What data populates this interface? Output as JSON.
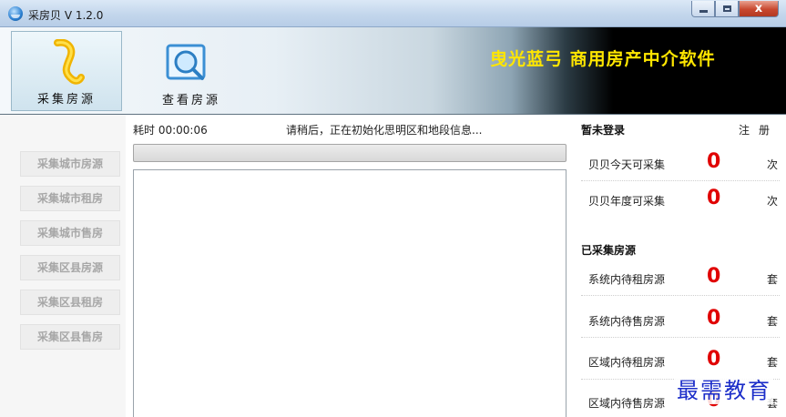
{
  "window": {
    "title": "采房贝 V 1.2.0",
    "buttons": {
      "minimize_icon": "minimize-icon",
      "maximize_icon": "maximize-icon",
      "close_label": "x"
    }
  },
  "toolbar": {
    "collect_label": "采集房源",
    "view_label": "查看房源",
    "brand": "曳光蓝弓 商用房产中介软件",
    "colors": {
      "brand": "#ffe600",
      "banner_dark": "#000000"
    }
  },
  "sidebar": {
    "items": [
      {
        "label": "采集城市房源"
      },
      {
        "label": "采集城市租房"
      },
      {
        "label": "采集城市售房"
      },
      {
        "label": "采集区县房源"
      },
      {
        "label": "采集区县租房"
      },
      {
        "label": "采集区县售房"
      }
    ]
  },
  "main": {
    "elapsed": "耗时 00:00:06",
    "status": "请稍后，正在初始化思明区和地段信息...",
    "progress": 0
  },
  "account": {
    "status": "暂未登录",
    "register": "注册",
    "stats": [
      {
        "label": "贝贝今天可采集",
        "value": "0",
        "unit": "次"
      },
      {
        "label": "贝贝年度可采集",
        "value": "0",
        "unit": "次"
      }
    ]
  },
  "collected": {
    "title": "已采集房源",
    "stats": [
      {
        "label": "系统内待租房源",
        "value": "0",
        "unit": "套"
      },
      {
        "label": "系统内待售房源",
        "value": "0",
        "unit": "套"
      },
      {
        "label": "区域内待租房源",
        "value": "0",
        "unit": "套"
      },
      {
        "label": "区域内待售房源",
        "value": "0",
        "unit": "套"
      }
    ],
    "value_color": "#e00000"
  },
  "watermark": "最需教育"
}
